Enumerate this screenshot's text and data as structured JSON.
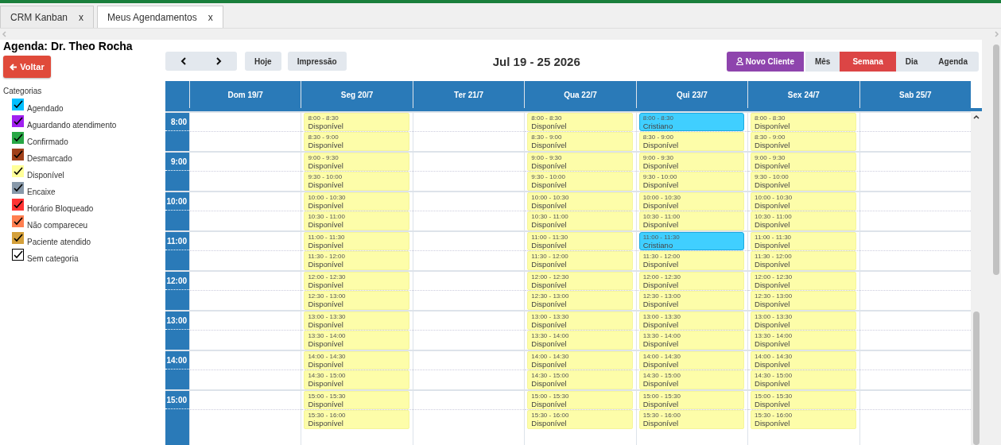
{
  "tabs": [
    {
      "label": "CRM Kanban",
      "close": "x",
      "selected": false
    },
    {
      "label": "Meus Agendamentos",
      "close": "x",
      "selected": true
    }
  ],
  "sidebar": {
    "title": "Agenda: Dr. Theo Rocha",
    "back_button": "Voltar",
    "categories_title": "Categorias",
    "categories": [
      {
        "label": "Agendado",
        "color": "#00bfff",
        "checked": true
      },
      {
        "label": "Aguardando atendimento",
        "color": "#a020f0",
        "checked": true
      },
      {
        "label": "Confirmado",
        "color": "#28a745",
        "checked": true
      },
      {
        "label": "Desmarcado",
        "color": "#a0401a",
        "checked": true
      },
      {
        "label": "Disponível",
        "color": "#ffff99",
        "checked": true
      },
      {
        "label": "Encaixe",
        "color": "#8899aa",
        "checked": true
      },
      {
        "label": "Horário Bloqueado",
        "color": "#ff3333",
        "checked": true
      },
      {
        "label": "Não compareceu",
        "color": "#ff7f50",
        "checked": true
      },
      {
        "label": "Paciente atendido",
        "color": "#d4a03a",
        "checked": true
      },
      {
        "label": "Sem categoria",
        "color": "#ffffff",
        "checked": true
      }
    ]
  },
  "toolbar": {
    "today": "Hoje",
    "print": "Impressão",
    "title": "Jul 19 - 25 2026",
    "new_client": "Novo Cliente",
    "views": [
      {
        "label": "Mês",
        "selected": false
      },
      {
        "label": "Semana",
        "selected": true
      },
      {
        "label": "Dia",
        "selected": false
      },
      {
        "label": "Agenda",
        "selected": false
      }
    ]
  },
  "calendar": {
    "hours": [
      "8:00",
      "9:00",
      "10:00",
      "11:00",
      "12:00",
      "13:00",
      "14:00",
      "15:00"
    ],
    "days": [
      {
        "label": "Dom 19/7"
      },
      {
        "label": "Seg 20/7",
        "slots": [
          {
            "time": "8:00 - 8:30",
            "label": "Disponível",
            "kind": "available"
          },
          {
            "time": "8:30 - 9:00",
            "label": "Disponível",
            "kind": "available"
          },
          {
            "time": "9:00 - 9:30",
            "label": "Disponível",
            "kind": "available"
          },
          {
            "time": "9:30 - 10:00",
            "label": "Disponível",
            "kind": "available"
          },
          {
            "time": "10:00 - 10:30",
            "label": "Disponível",
            "kind": "available"
          },
          {
            "time": "10:30 - 11:00",
            "label": "Disponível",
            "kind": "available"
          },
          {
            "time": "11:00 - 11:30",
            "label": "Disponível",
            "kind": "available"
          },
          {
            "time": "11:30 - 12:00",
            "label": "Disponível",
            "kind": "available"
          },
          {
            "time": "12:00 - 12:30",
            "label": "Disponível",
            "kind": "available"
          },
          {
            "time": "12:30 - 13:00",
            "label": "Disponível",
            "kind": "available"
          },
          {
            "time": "13:00 - 13:30",
            "label": "Disponível",
            "kind": "available"
          },
          {
            "time": "13:30 - 14:00",
            "label": "Disponível",
            "kind": "available"
          },
          {
            "time": "14:00 - 14:30",
            "label": "Disponível",
            "kind": "available"
          },
          {
            "time": "14:30 - 15:00",
            "label": "Disponível",
            "kind": "available"
          },
          {
            "time": "15:00 - 15:30",
            "label": "Disponível",
            "kind": "available"
          },
          {
            "time": "15:30 - 16:00",
            "label": "Disponível",
            "kind": "available"
          }
        ]
      },
      {
        "label": "Ter 21/7"
      },
      {
        "label": "Qua 22/7",
        "slots": [
          {
            "time": "8:00 - 8:30",
            "label": "Disponível",
            "kind": "available"
          },
          {
            "time": "8:30 - 9:00",
            "label": "Disponível",
            "kind": "available"
          },
          {
            "time": "9:00 - 9:30",
            "label": "Disponível",
            "kind": "available"
          },
          {
            "time": "9:30 - 10:00",
            "label": "Disponível",
            "kind": "available"
          },
          {
            "time": "10:00 - 10:30",
            "label": "Disponível",
            "kind": "available"
          },
          {
            "time": "10:30 - 11:00",
            "label": "Disponível",
            "kind": "available"
          },
          {
            "time": "11:00 - 11:30",
            "label": "Disponível",
            "kind": "available"
          },
          {
            "time": "11:30 - 12:00",
            "label": "Disponível",
            "kind": "available"
          },
          {
            "time": "12:00 - 12:30",
            "label": "Disponível",
            "kind": "available"
          },
          {
            "time": "12:30 - 13:00",
            "label": "Disponível",
            "kind": "available"
          },
          {
            "time": "13:00 - 13:30",
            "label": "Disponível",
            "kind": "available"
          },
          {
            "time": "13:30 - 14:00",
            "label": "Disponível",
            "kind": "available"
          },
          {
            "time": "14:00 - 14:30",
            "label": "Disponível",
            "kind": "available"
          },
          {
            "time": "14:30 - 15:00",
            "label": "Disponível",
            "kind": "available"
          },
          {
            "time": "15:00 - 15:30",
            "label": "Disponível",
            "kind": "available"
          },
          {
            "time": "15:30 - 16:00",
            "label": "Disponível",
            "kind": "available"
          }
        ]
      },
      {
        "label": "Qui 23/7",
        "slots": [
          {
            "time": "8:00 - 8:30",
            "label": "Cristiano",
            "kind": "booked"
          },
          {
            "time": "8:30 - 9:00",
            "label": "Disponível",
            "kind": "available"
          },
          {
            "time": "9:00 - 9:30",
            "label": "Disponível",
            "kind": "available"
          },
          {
            "time": "9:30 - 10:00",
            "label": "Disponível",
            "kind": "available"
          },
          {
            "time": "10:00 - 10:30",
            "label": "Disponível",
            "kind": "available"
          },
          {
            "time": "10:30 - 11:00",
            "label": "Disponível",
            "kind": "available"
          },
          {
            "time": "11:00 - 11:30",
            "label": "Cristiano",
            "kind": "booked"
          },
          {
            "time": "11:30 - 12:00",
            "label": "Disponível",
            "kind": "available"
          },
          {
            "time": "12:00 - 12:30",
            "label": "Disponível",
            "kind": "available"
          },
          {
            "time": "12:30 - 13:00",
            "label": "Disponível",
            "kind": "available"
          },
          {
            "time": "13:00 - 13:30",
            "label": "Disponível",
            "kind": "available"
          },
          {
            "time": "13:30 - 14:00",
            "label": "Disponível",
            "kind": "available"
          },
          {
            "time": "14:00 - 14:30",
            "label": "Disponível",
            "kind": "available"
          },
          {
            "time": "14:30 - 15:00",
            "label": "Disponível",
            "kind": "available"
          },
          {
            "time": "15:00 - 15:30",
            "label": "Disponível",
            "kind": "available"
          },
          {
            "time": "15:30 - 16:00",
            "label": "Disponível",
            "kind": "available"
          }
        ]
      },
      {
        "label": "Sex 24/7",
        "slots": [
          {
            "time": "8:00 - 8:30",
            "label": "Disponível",
            "kind": "available"
          },
          {
            "time": "8:30 - 9:00",
            "label": "Disponível",
            "kind": "available"
          },
          {
            "time": "9:00 - 9:30",
            "label": "Disponível",
            "kind": "available"
          },
          {
            "time": "9:30 - 10:00",
            "label": "Disponível",
            "kind": "available"
          },
          {
            "time": "10:00 - 10:30",
            "label": "Disponível",
            "kind": "available"
          },
          {
            "time": "10:30 - 11:00",
            "label": "Disponível",
            "kind": "available"
          },
          {
            "time": "11:00 - 11:30",
            "label": "Disponível",
            "kind": "available"
          },
          {
            "time": "11:30 - 12:00",
            "label": "Disponível",
            "kind": "available"
          },
          {
            "time": "12:00 - 12:30",
            "label": "Disponível",
            "kind": "available"
          },
          {
            "time": "12:30 - 13:00",
            "label": "Disponível",
            "kind": "available"
          },
          {
            "time": "13:00 - 13:30",
            "label": "Disponível",
            "kind": "available"
          },
          {
            "time": "13:30 - 14:00",
            "label": "Disponível",
            "kind": "available"
          },
          {
            "time": "14:00 - 14:30",
            "label": "Disponível",
            "kind": "available"
          },
          {
            "time": "14:30 - 15:00",
            "label": "Disponível",
            "kind": "available"
          },
          {
            "time": "15:00 - 15:30",
            "label": "Disponível",
            "kind": "available"
          },
          {
            "time": "15:30 - 16:00",
            "label": "Disponível",
            "kind": "available"
          }
        ]
      },
      {
        "label": "Sab 25/7"
      }
    ]
  }
}
